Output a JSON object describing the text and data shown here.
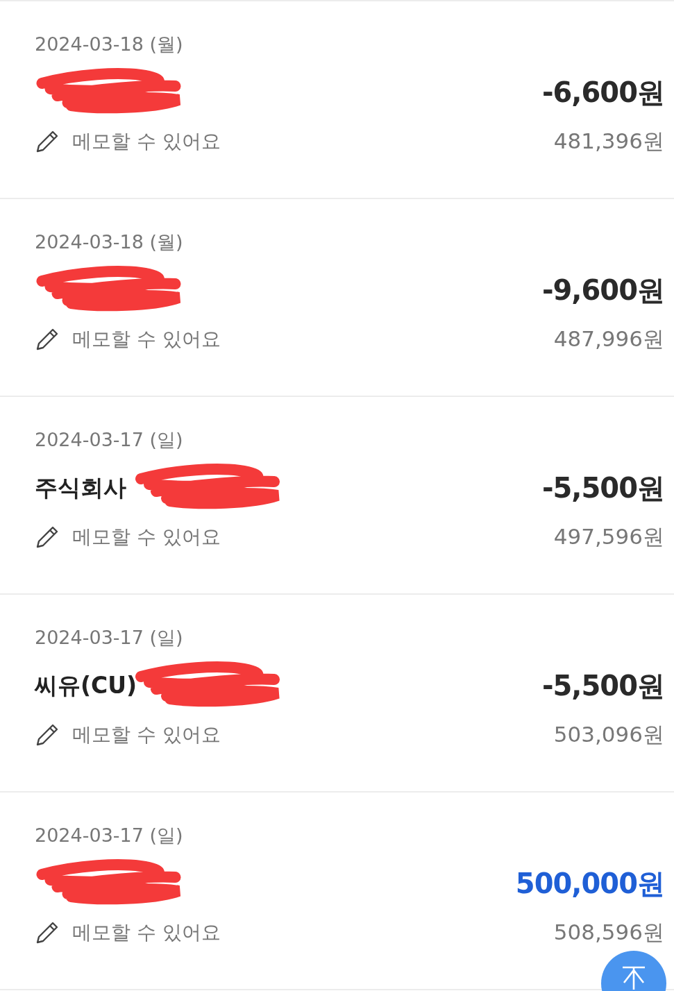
{
  "transactions": [
    {
      "date": "2024-03-18 (월)",
      "redacted": true,
      "kind": "withdrawal",
      "amount": "-6,600원",
      "memo_placeholder": "메모할 수 있어요",
      "balance": "481,396원"
    },
    {
      "date": "2024-03-18 (월)",
      "redacted": true,
      "kind": "withdrawal",
      "amount": "-9,600원",
      "memo_placeholder": "메모할 수 있어요",
      "balance": "487,996원"
    },
    {
      "date": "2024-03-17 (일)",
      "name": "주식회사",
      "redacted": true,
      "kind": "withdrawal",
      "amount": "-5,500원",
      "memo_placeholder": "메모할 수 있어요",
      "balance": "497,596원"
    },
    {
      "date": "2024-03-17 (일)",
      "name": "씨유(CU)",
      "redacted": true,
      "kind": "withdrawal",
      "amount": "-5,500원",
      "memo_placeholder": "메모할 수 있어요",
      "balance": "503,096원"
    },
    {
      "date": "2024-03-17 (일)",
      "redacted": true,
      "kind": "deposit",
      "amount": "500,000원",
      "memo_placeholder": "메모할 수 있어요",
      "balance": "508,596원"
    }
  ],
  "scroll_top_button": {
    "visible": true
  }
}
